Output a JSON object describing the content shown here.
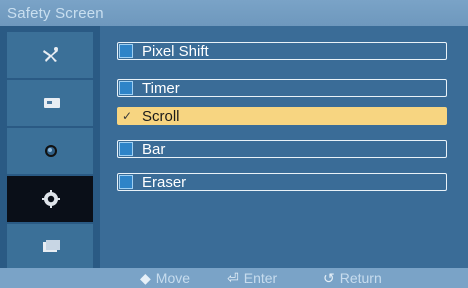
{
  "title": "Safety Screen",
  "sidebar": {
    "items": [
      {
        "icon": "satellite-dish-icon",
        "active": false
      },
      {
        "icon": "monitor-input-icon",
        "active": false
      },
      {
        "icon": "sound-speaker-icon",
        "active": false
      },
      {
        "icon": "gear-icon",
        "active": true
      },
      {
        "icon": "multi-screen-icon",
        "active": false
      }
    ]
  },
  "menu": {
    "items": [
      {
        "label": "Pixel Shift",
        "selected": false
      },
      {
        "label": "Timer",
        "selected": false
      },
      {
        "label": "Scroll",
        "selected": true,
        "check": "✓"
      },
      {
        "label": "Bar",
        "selected": false
      },
      {
        "label": "Eraser",
        "selected": false
      }
    ]
  },
  "footer": {
    "move": "Move",
    "enter": "Enter",
    "return": "Return"
  },
  "colors": {
    "background": "#3a6c97",
    "sidebar": "#2a5a84",
    "selected_item": "#f7d581",
    "title_bar": "#7aa3c7",
    "active_side_item": "#0a0f18"
  }
}
